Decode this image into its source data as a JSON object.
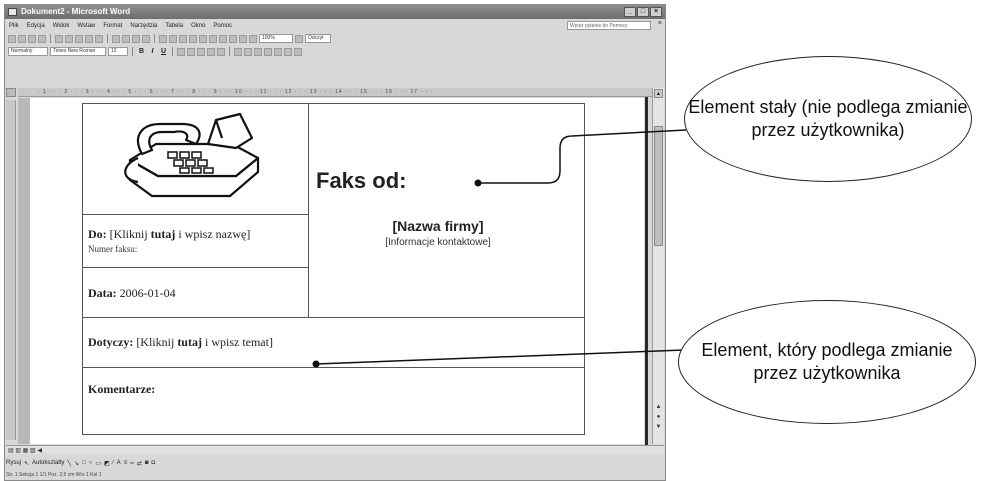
{
  "window": {
    "title": "Dokument2 - Microsoft Word",
    "controls": [
      "_",
      "□",
      "×"
    ]
  },
  "menu": {
    "items": [
      "Plik",
      "Edycja",
      "Widok",
      "Wstaw",
      "Format",
      "Narzędzia",
      "Tabela",
      "Okno",
      "Pomoc"
    ],
    "help_placeholder": "Wpisz pytanie do Pomocy"
  },
  "formatting": {
    "style": "Normalny",
    "font": "Times New Roman",
    "size": "12",
    "zoom": "100%",
    "read_label": "Odczyt"
  },
  "ruler": {
    "marks": "· 1 · · · 2 · · · 3 · · · 4 · · · 5 · · · 6 · · · 7 · · · 8 · · · 9 · · · 10 · · · 11 · · · 12 · · · 13 · · · 14 · · · 15 · · · 16 · · · 17 · · ·"
  },
  "fax": {
    "title": "Faks od:",
    "company": "[Nazwa firmy]",
    "contact": "[Informacje kontaktowe]",
    "to_label": "Do:",
    "to_text_pre": "[Kliknij ",
    "to_text_bold": "tutaj",
    "to_text_post": " i wpisz nazwę]",
    "fax_number_label": "Numer faksu:",
    "date_label": "Data:",
    "date_value": "2006-01-04",
    "subject_label": "Dotyczy:",
    "subject_pre": "[Kliknij ",
    "subject_bold": "tutaj",
    "subject_post": " i wpisz temat]",
    "comments_label": "Komentarze:"
  },
  "drawing": {
    "draw_label": "Rysuj",
    "autoshapes_label": "Autokształty"
  },
  "status": {
    "text": "Str. 1   Sekcja 1   1/1   Poz. 2,5 cm   Wrs 1   Kol 1"
  },
  "callouts": {
    "fixed": "Element stały (nie podlega zmianie przez użytkownika)",
    "editable": "Element, który podlega zmianie przez użytkownika"
  }
}
